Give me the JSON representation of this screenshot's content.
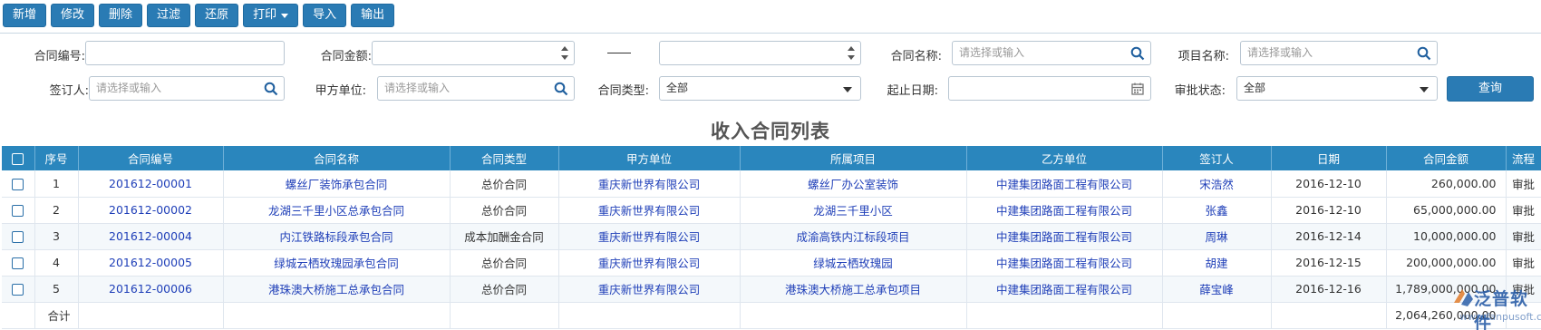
{
  "toolbar": {
    "buttons": [
      "新增",
      "修改",
      "删除",
      "过滤",
      "还原",
      "打印",
      "导入",
      "输出"
    ]
  },
  "filters": {
    "contract_no": {
      "label": "合同编号:",
      "value": ""
    },
    "contract_amount": {
      "label": "合同金额:",
      "from": "",
      "separator": "——",
      "to": ""
    },
    "contract_name": {
      "label": "合同名称:",
      "placeholder": "请选择或输入"
    },
    "project_name": {
      "label": "项目名称:",
      "placeholder": "请选择或输入"
    },
    "signer": {
      "label": "签订人:",
      "placeholder": "请选择或输入"
    },
    "party_a": {
      "label": "甲方单位:",
      "placeholder": "请选择或输入"
    },
    "contract_type": {
      "label": "合同类型:",
      "value": "全部"
    },
    "date_range": {
      "label": "起止日期:",
      "value": ""
    },
    "approval_status": {
      "label": "审批状态:",
      "value": "全部"
    },
    "query_label": "查询"
  },
  "title": "收入合同列表",
  "table": {
    "columns": [
      "序号",
      "合同编号",
      "合同名称",
      "合同类型",
      "甲方单位",
      "所属项目",
      "乙方单位",
      "签订人",
      "日期",
      "合同金额",
      "流程"
    ],
    "rows": [
      {
        "seq": "1",
        "no": "201612-00001",
        "name": "螺丝厂装饰承包合同",
        "type": "总价合同",
        "party_a": "重庆新世界有限公司",
        "project": "螺丝厂办公室装饰",
        "party_b": "中建集团路面工程有限公司",
        "signer": "宋浩然",
        "date": "2016-12-10",
        "amount": "260,000.00",
        "flow": "审批"
      },
      {
        "seq": "2",
        "no": "201612-00002",
        "name": "龙湖三千里小区总承包合同",
        "type": "总价合同",
        "party_a": "重庆新世界有限公司",
        "project": "龙湖三千里小区",
        "party_b": "中建集团路面工程有限公司",
        "signer": "张鑫",
        "date": "2016-12-10",
        "amount": "65,000,000.00",
        "flow": "审批"
      },
      {
        "seq": "3",
        "no": "201612-00004",
        "name": "内江铁路标段承包合同",
        "type": "成本加酬金合同",
        "party_a": "重庆新世界有限公司",
        "project": "成渝高铁内江标段项目",
        "party_b": "中建集团路面工程有限公司",
        "signer": "周琳",
        "date": "2016-12-14",
        "amount": "10,000,000.00",
        "flow": "审批"
      },
      {
        "seq": "4",
        "no": "201612-00005",
        "name": "绿城云栖玫瑰园承包合同",
        "type": "总价合同",
        "party_a": "重庆新世界有限公司",
        "project": "绿城云栖玫瑰园",
        "party_b": "中建集团路面工程有限公司",
        "signer": "胡建",
        "date": "2016-12-15",
        "amount": "200,000,000.00",
        "flow": "审批"
      },
      {
        "seq": "5",
        "no": "201612-00006",
        "name": "港珠澳大桥施工总承包合同",
        "type": "总价合同",
        "party_a": "重庆新世界有限公司",
        "project": "港珠澳大桥施工总承包项目",
        "party_b": "中建集团路面工程有限公司",
        "signer": "薛宝峰",
        "date": "2016-12-16",
        "amount": "1,789,000,000.00",
        "flow": "审批"
      }
    ],
    "total_label": "合计",
    "total_amount": "2,064,260,000.00"
  },
  "watermark": {
    "brand": "泛普软件",
    "site": "www.fanpusoft.com"
  },
  "colors": {
    "primary": "#2a7bb4",
    "header": "#2a86bd",
    "link": "#1f3fb8"
  }
}
